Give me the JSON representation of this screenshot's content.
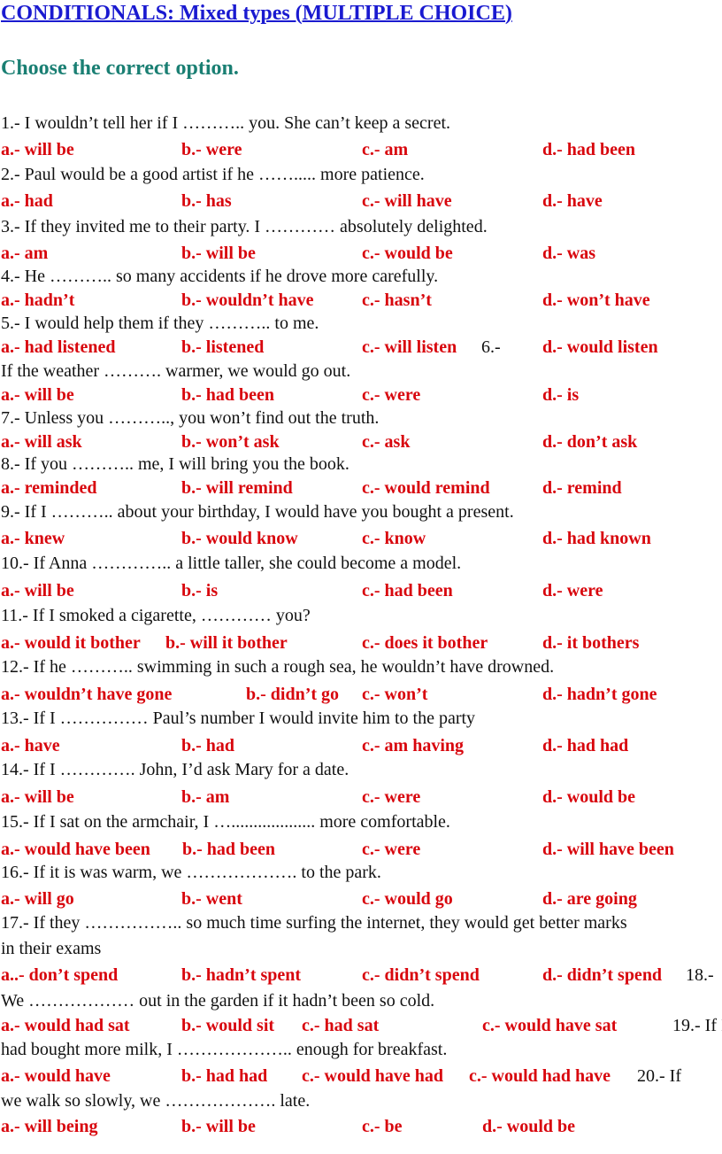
{
  "title": "CONDITIONALS: Mixed types (MULTIPLE CHOICE)",
  "subtitle": "Choose the correct option.",
  "colors": {
    "title": "#1a1ad0",
    "subtitle": "#1a7f73",
    "options": "#d8060d",
    "text": "#111111"
  },
  "questions": [
    {
      "text": "1.- I wouldn’t tell her if I ……….. you. She can’t keep a secret.",
      "options": [
        "a.- will be",
        "b.- were",
        "c.- am",
        "d.- had been"
      ]
    },
    {
      "text": "2.- Paul would be a good artist if he ……..... more patience.",
      "options": [
        "a.- had",
        "b.- has",
        "c.- will have",
        "d.- have"
      ]
    },
    {
      "text": "3.- If they invited me to their party. I ………… absolutely delighted.",
      "options": [
        "a.- am",
        "b.- will be",
        "c.- would be",
        "d.- was"
      ]
    },
    {
      "text": "4.- He ……….. so many accidents if he drove more carefully.",
      "options": [
        "a.- hadn’t",
        "b.- wouldn’t have",
        "c.- hasn’t",
        "d.- won’t have"
      ]
    },
    {
      "text": "5.- I would help them if they ……….. to me.",
      "options": [
        "a.- had listened",
        "b.- listened",
        "c.- will listen",
        "d.- would listen"
      ],
      "inline_tail": "6.-"
    },
    {
      "text": "If the weather ………. warmer, we would go out.",
      "options": [
        "a.- will be",
        "b.- had been",
        "c.- were",
        "d.- is"
      ]
    },
    {
      "text": "7.- Unless you ……….., you won’t find out the truth.",
      "options": [
        "a.- will ask",
        "b.- won’t ask",
        "c.- ask",
        "d.- don’t ask"
      ]
    },
    {
      "text": "8.- If you ……….. me, I will bring you the book.",
      "options": [
        "a.- reminded",
        "b.- will remind",
        "c.- would remind",
        "d.- remind"
      ]
    },
    {
      "text": "9.- If I ……….. about your birthday, I would have you bought a present.",
      "options": [
        "a.- knew",
        "b.- would know",
        "c.- know",
        "d.- had known"
      ]
    },
    {
      "text": "10.- If Anna ………….. a little taller, she could become a model.",
      "options": [
        "a.- will be",
        "b.- is",
        "c.- had been",
        "d.- were"
      ]
    },
    {
      "text": "11.- If I smoked a cigarette, ………… you?",
      "options": [
        "a.- would it bother",
        "b.- will it bother",
        "c.- does it bother",
        "d.- it bothers"
      ]
    },
    {
      "text": "12.- If he ……….. swimming in such a rough sea, he wouldn’t have drowned.",
      "options": [
        "a.- wouldn’t have gone",
        "b.- didn’t go",
        "c.- won’t",
        "d.- hadn’t gone"
      ]
    },
    {
      "text": "13.- If I …………… Paul’s number I would invite him to the party",
      "options": [
        "a.- have",
        "b.- had",
        "c.-  am having",
        "d.- had had"
      ]
    },
    {
      "text": "14.- If I …………. John, I’d ask Mary for a date.",
      "options": [
        "a.- will be",
        "b.- am",
        "c.- were",
        "d.- would be"
      ]
    },
    {
      "text": "15.- If I  sat on the armchair, I …................... more comfortable.",
      "options": [
        "a.- would have been",
        "b.- had been",
        "c.- were",
        "d.- will have been"
      ]
    },
    {
      "text": "16.- If it is was warm, we ………………. to the park.",
      "options": [
        "a.- will go",
        "b.- went",
        "c.- would go",
        "d.- are going"
      ]
    },
    {
      "text": "17.- If they …………….. so much time surfing the internet, they would get better marks",
      "text_cont": "in their exams",
      "options": [
        "a..- don’t spend",
        "b.- hadn’t spent",
        "c.- didn’t spend",
        "d.- didn’t spend"
      ],
      "inline_tail": "18.-"
    },
    {
      "text": "We ……………… out in the garden if it hadn’t been so cold.",
      "options": [
        "a.- would had sat",
        "b.- would sit",
        "c.- had sat",
        "c.- would have sat"
      ],
      "inline_tail": "19.- If I"
    },
    {
      "text": "had bought more milk, I ……………….. enough for breakfast.",
      "options": [
        "a.- would have",
        "b.- had had",
        "c.- would have had",
        "c.- would had have"
      ],
      "inline_tail": "20.- If"
    },
    {
      "text": "we walk so slowly, we ………………. late.",
      "options": [
        "a.- will being",
        "b.- will be",
        "c.- be",
        "d.- would be"
      ]
    }
  ]
}
